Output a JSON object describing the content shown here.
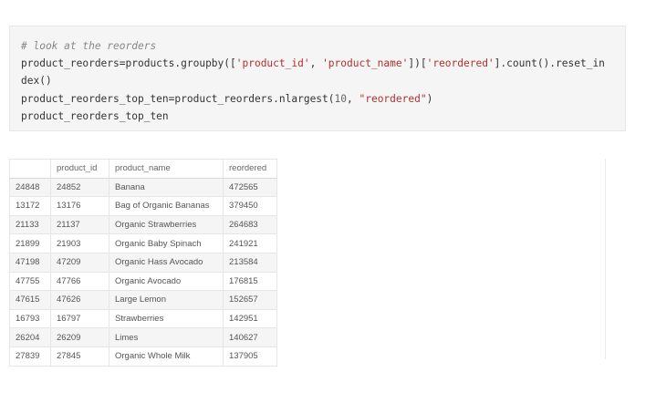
{
  "code_cell": {
    "comment": "# look at the reorders",
    "line1_a": "product_reorders=products.groupby([",
    "line1_s1": "'product_id'",
    "line1_b": ", ",
    "line1_s2": "'product_name'",
    "line1_c": "])[",
    "line1_s3": "'reordered'",
    "line1_d": "].count().reset_in",
    "line2": "dex()",
    "line3_a": "product_reorders_top_ten=product_reorders.nlargest(",
    "line3_num": "10",
    "line3_b": ", ",
    "line3_s": "\"reordered\"",
    "line3_c": ")",
    "line4": "product_reorders_top_ten"
  },
  "table": {
    "columns": [
      "",
      "product_id",
      "product_name",
      "reordered"
    ],
    "rows": [
      {
        "index": "24848",
        "product_id": "24852",
        "product_name": "Banana",
        "reordered": "472565"
      },
      {
        "index": "13172",
        "product_id": "13176",
        "product_name": "Bag of Organic Bananas",
        "reordered": "379450"
      },
      {
        "index": "21133",
        "product_id": "21137",
        "product_name": "Organic Strawberries",
        "reordered": "264683"
      },
      {
        "index": "21899",
        "product_id": "21903",
        "product_name": "Organic Baby Spinach",
        "reordered": "241921"
      },
      {
        "index": "47198",
        "product_id": "47209",
        "product_name": "Organic Hass Avocado",
        "reordered": "213584"
      },
      {
        "index": "47755",
        "product_id": "47766",
        "product_name": "Organic Avocado",
        "reordered": "176815"
      },
      {
        "index": "47615",
        "product_id": "47626",
        "product_name": "Large Lemon",
        "reordered": "152657"
      },
      {
        "index": "16793",
        "product_id": "16797",
        "product_name": "Strawberries",
        "reordered": "142951"
      },
      {
        "index": "26204",
        "product_id": "26209",
        "product_name": "Limes",
        "reordered": "140627"
      },
      {
        "index": "27839",
        "product_id": "27845",
        "product_name": "Organic Whole Milk",
        "reordered": "137905"
      }
    ]
  }
}
